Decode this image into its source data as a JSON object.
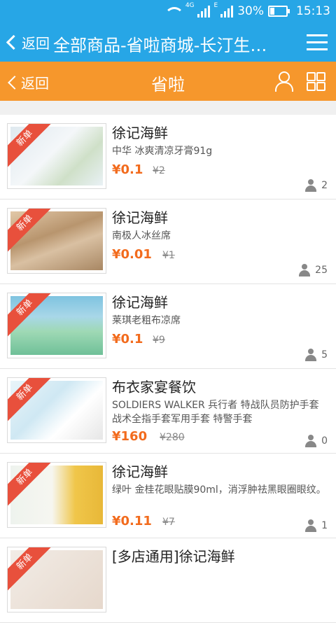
{
  "status": {
    "battery": "30%",
    "time": "15:13",
    "net1": "4G",
    "net2": "E",
    "battery_level": 0.3
  },
  "browser": {
    "back": "返回",
    "title": "全部商品-省啦商城-长汀生…"
  },
  "appbar": {
    "back": "返回",
    "title": "省啦"
  },
  "badge": "新单",
  "items": [
    {
      "shop": "徐记海鲜",
      "desc": "中华 冰爽清凉牙膏91g",
      "price": "¥0.1",
      "old_price": "¥2",
      "sold": "2"
    },
    {
      "shop": "徐记海鲜",
      "desc": "南极人冰丝席",
      "price": "¥0.01",
      "old_price": "¥1",
      "sold": "25"
    },
    {
      "shop": "徐记海鲜",
      "desc": "莱琪老粗布凉席",
      "price": "¥0.1",
      "old_price": "¥9",
      "sold": "5"
    },
    {
      "shop": "布衣家宴餐饮",
      "desc": "SOLDIERS WALKER 兵行者 特战队员防护手套 战术全指手套军用手套 特警手套",
      "price": "¥160",
      "old_price": "¥280",
      "sold": "0"
    },
    {
      "shop": "徐记海鲜",
      "desc": "绿叶 金桂花眼贴膜90ml，消浮肿祛黑眼圈眼纹。",
      "price": "¥0.11",
      "old_price": "¥7",
      "sold": "1"
    },
    {
      "shop": "[多店通用]徐记海鲜",
      "desc": "",
      "price": "",
      "old_price": "",
      "sold": ""
    }
  ],
  "colors": {
    "primary": "#27a6e6",
    "accent": "#f6972c",
    "price": "#f26b1d",
    "badge": "#e8503c"
  }
}
